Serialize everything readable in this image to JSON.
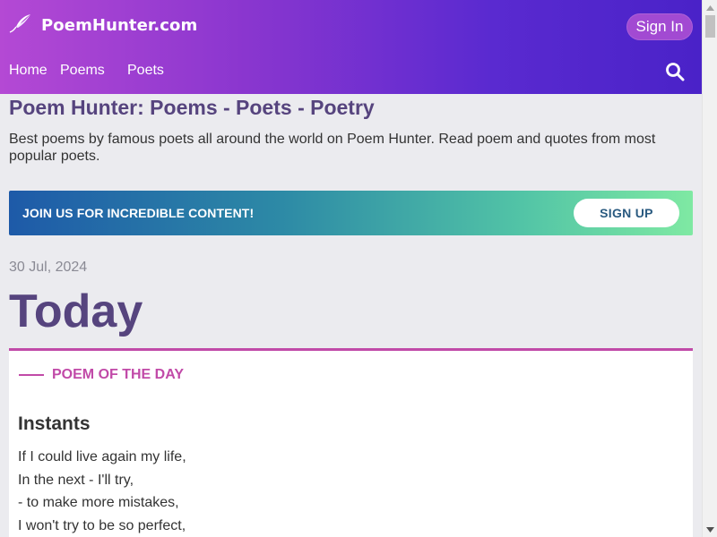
{
  "header": {
    "logo_text": "PoemHunter.com",
    "signin_label": "Sign In",
    "nav": [
      {
        "label": "Home"
      },
      {
        "label": "Poems"
      },
      {
        "label": "Poets"
      }
    ]
  },
  "page": {
    "title": "Poem Hunter: Poems - Poets - Poetry",
    "description": "Best poems by famous poets all around the world on Poem Hunter. Read poem and quotes from most popular poets."
  },
  "banner": {
    "text": "JOIN US FOR INCREDIBLE CONTENT!",
    "button_label": "SIGN UP"
  },
  "today": {
    "date": "30 Jul, 2024",
    "heading": "Today"
  },
  "poem_of_day": {
    "label": "POEM OF THE DAY",
    "title": "Instants",
    "lines": [
      "If I could live again my life,",
      "In the next - I'll try,",
      "- to make more mistakes,",
      "I won't try to be so perfect,"
    ]
  },
  "colors": {
    "header_gradient_start": "#b449d4",
    "header_gradient_end": "#4a22c8",
    "title_purple": "#56447e",
    "accent_pink": "#c14aa8",
    "banner_gradient_start": "#1e5aa8",
    "banner_gradient_end": "#7fe9a3"
  },
  "icons": {
    "logo": "quill-icon",
    "search": "search-icon"
  }
}
